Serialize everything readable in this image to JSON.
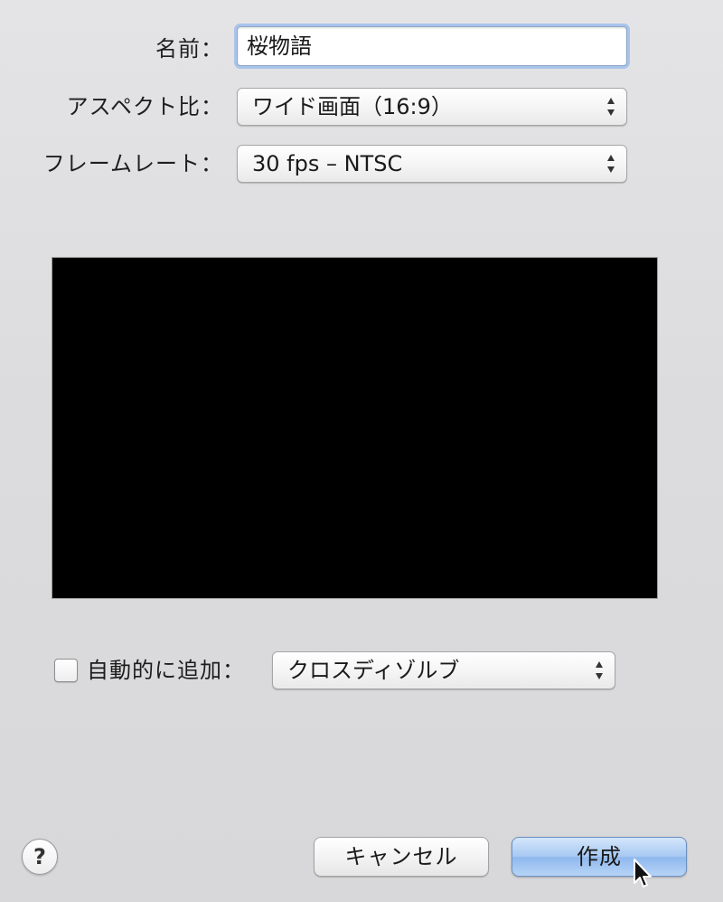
{
  "form": {
    "name_label": "名前：",
    "name_value": "桜物語",
    "aspect_label": "アスペクト比：",
    "aspect_value": "ワイド画面（16:9）",
    "framerate_label": "フレームレート：",
    "framerate_value": "30 fps – NTSC"
  },
  "auto_add": {
    "checked": false,
    "label": "自動的に追加：",
    "value": "クロスディゾルブ"
  },
  "buttons": {
    "help_label": "?",
    "cancel_label": "キャンセル",
    "create_label": "作成"
  },
  "colors": {
    "focus_ring": "#a9c4ea",
    "default_button": "#a6c8f2",
    "preview_background": "#000000"
  },
  "icons": {
    "popup_arrows": "up-down-arrows-icon",
    "cursor": "mouse-pointer-icon"
  }
}
